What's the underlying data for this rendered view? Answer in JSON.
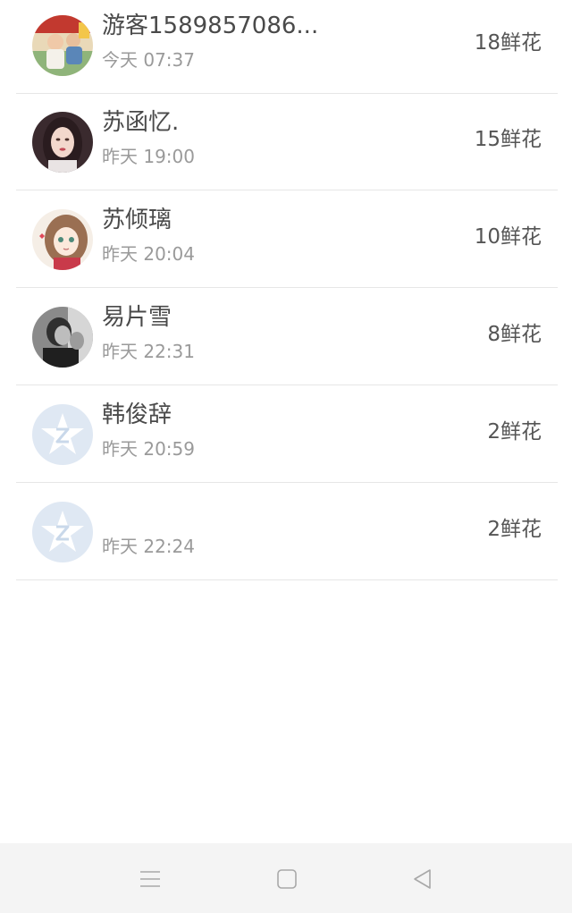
{
  "records": [
    {
      "name": "游客1589857086...",
      "time": "今天 07:37",
      "flowers": "18鲜花",
      "avatar_icon": "child-photo-avatar"
    },
    {
      "name": "苏函忆.",
      "time": "昨天 19:00",
      "flowers": "15鲜花",
      "avatar_icon": "woman-photo-avatar"
    },
    {
      "name": "苏倾璃",
      "time": "昨天 20:04",
      "flowers": "10鲜花",
      "avatar_icon": "anime-girl-avatar"
    },
    {
      "name": "易片雪",
      "time": "昨天 22:31",
      "flowers": "8鲜花",
      "avatar_icon": "bw-photo-avatar"
    },
    {
      "name": "韩俊辞",
      "time": "昨天 20:59",
      "flowers": "2鲜花",
      "avatar_icon": "default-star-avatar"
    },
    {
      "name": "",
      "time": "昨天 22:24",
      "flowers": "2鲜花",
      "avatar_icon": "default-star-avatar"
    }
  ],
  "navbar": {
    "menu_icon": "menu-icon",
    "home_icon": "home-square-icon",
    "back_icon": "back-triangle-icon"
  },
  "colors": {
    "name_text": "#4a4a4a",
    "time_text": "#9a9a9a",
    "flowers_text": "#555555",
    "divider": "#e6e6e6",
    "navbar_bg": "#f4f4f4",
    "default_avatar_bg": "#dfe8f3"
  }
}
